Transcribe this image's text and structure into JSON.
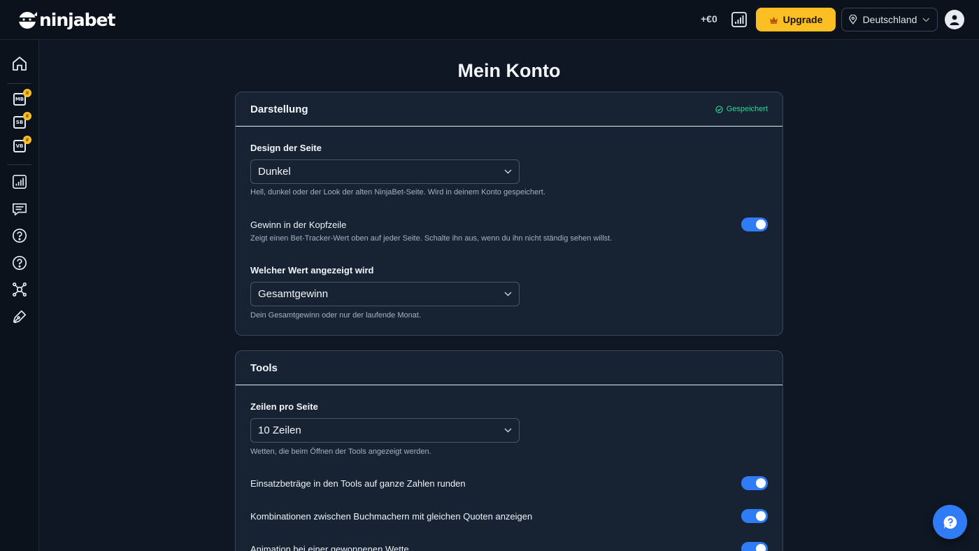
{
  "header": {
    "logo_text": "ninjabet",
    "profit": "+€0",
    "upgrade_label": "Upgrade",
    "country_label": "Deutschland"
  },
  "sidebar": {
    "items": [
      {
        "icon": "home-icon"
      },
      {
        "icon": "mb-badge-icon",
        "abbr": "MB"
      },
      {
        "icon": "sb-badge-icon",
        "abbr": "SB"
      },
      {
        "icon": "vb-badge-icon",
        "abbr": "VB"
      },
      {
        "icon": "bar-chart-icon"
      },
      {
        "icon": "chat-icon"
      },
      {
        "icon": "help-circle-icon"
      },
      {
        "icon": "help-circle-icon"
      },
      {
        "icon": "network-icon"
      },
      {
        "icon": "pen-tool-icon"
      }
    ]
  },
  "main": {
    "title": "Mein Konto",
    "darstellung": {
      "title": "Darstellung",
      "saved_label": "Gespeichert",
      "design_label": "Design der Seite",
      "design_value": "Dunkel",
      "design_hint": "Hell, dunkel oder der Look der alten NinjaBet-Seite. Wird in deinem Konto gespeichert.",
      "header_profit_label": "Gewinn in der Kopfzeile",
      "header_profit_hint": "Zeigt einen Bet-Tracker-Wert oben auf jeder Seite. Schalte ihn aus, wenn du ihn nicht ständig sehen willst.",
      "header_profit_on": true,
      "value_label": "Welcher Wert angezeigt wird",
      "value_value": "Gesamtgewinn",
      "value_hint": "Dein Gesamtgewinn oder nur der laufende Monat."
    },
    "tools": {
      "title": "Tools",
      "rows_label": "Zeilen pro Seite",
      "rows_value": "10 Zeilen",
      "rows_hint": "Wetten, die beim Öffnen der Tools angezeigt werden.",
      "round_label": "Einsatzbeträge in den Tools auf ganze Zahlen runden",
      "round_on": true,
      "combos_label": "Kombinationen zwischen Buchmachern mit gleichen Quoten anzeigen",
      "combos_on": true,
      "animation_label": "Animation bei einer gewonnenen Wette",
      "animation_on": true
    }
  },
  "colors": {
    "accent": "#2f7cf6",
    "upgrade": "#fbbf24",
    "saved": "#34d399",
    "background": "#0f1724",
    "card": "#172233"
  }
}
